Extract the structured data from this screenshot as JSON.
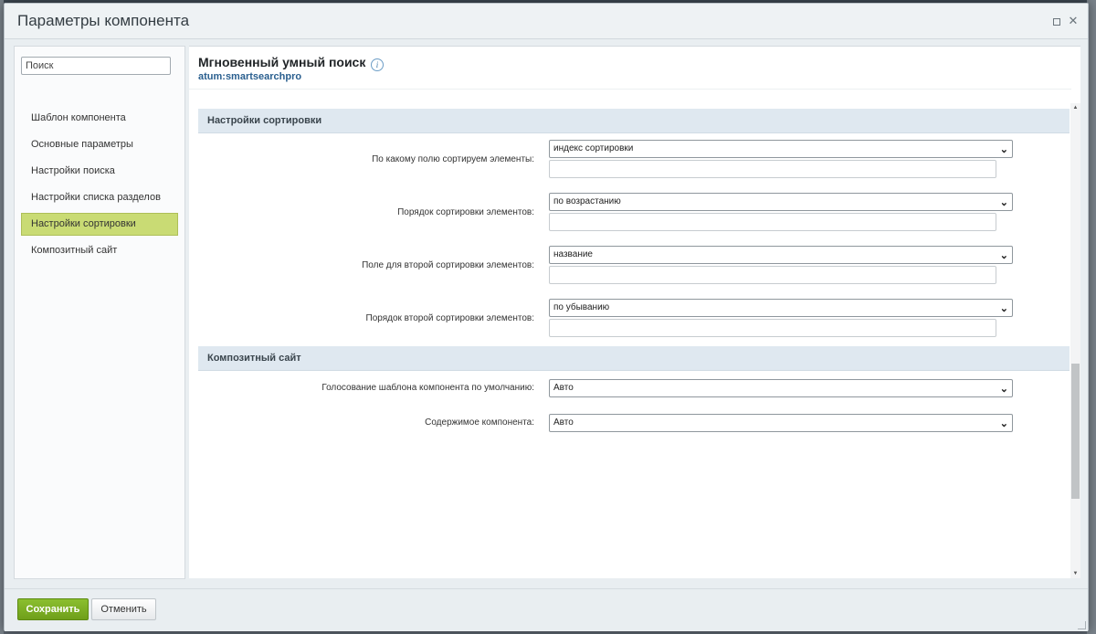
{
  "dialog": {
    "title": "Параметры компонента"
  },
  "sidebar": {
    "search_placeholder": "Поиск",
    "items": [
      {
        "label": "Шаблон компонента"
      },
      {
        "label": "Основные параметры"
      },
      {
        "label": "Настройки поиска"
      },
      {
        "label": "Настройки списка разделов"
      },
      {
        "label": "Настройки сортировки",
        "active": true
      },
      {
        "label": "Композитный сайт"
      }
    ]
  },
  "component": {
    "title": "Мгновенный умный поиск",
    "code": "atum:smartsearchpro",
    "info_icon": "info-icon"
  },
  "sections": [
    {
      "title": "Настройки сортировки",
      "rows": [
        {
          "label": "По какому полю сортируем элементы:",
          "value": "индекс сортировки",
          "extra_input": ""
        },
        {
          "label": "Порядок сортировки элементов:",
          "value": "по возрастанию",
          "extra_input": ""
        },
        {
          "label": "Поле для второй сортировки элементов:",
          "value": "название",
          "extra_input": ""
        },
        {
          "label": "Порядок второй сортировки элементов:",
          "value": "по убыванию",
          "extra_input": ""
        }
      ]
    },
    {
      "title": "Композитный сайт",
      "rows": [
        {
          "label": "Голосование шаблона компонента по умолчанию:",
          "value": "Авто"
        },
        {
          "label": "Содержимое компонента:",
          "value": "Авто"
        }
      ]
    }
  ],
  "footer": {
    "save_label": "Сохранить",
    "cancel_label": "Отменить"
  },
  "colors": {
    "accent": "#c9db74",
    "save_button": "#7aad22",
    "section_header": "#dfe8f0"
  }
}
